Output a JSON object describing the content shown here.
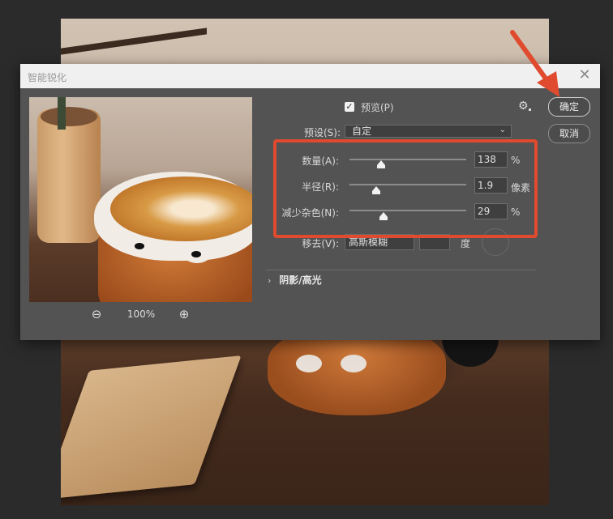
{
  "dialog": {
    "title": "智能锐化",
    "close_glyph": "✕"
  },
  "preview_panel": {
    "zoom_level": "100%",
    "zoom_out_glyph": "⊖",
    "zoom_in_glyph": "⊕"
  },
  "preview_toggle": {
    "checked": true,
    "check_glyph": "✓",
    "label": "预览(P)"
  },
  "gear_glyph": "⚙",
  "preset": {
    "label": "预设(S):",
    "value": "自定",
    "chevron": "⌄"
  },
  "sliders": [
    {
      "label": "数量(A):",
      "value": "138",
      "unit": "%",
      "fraction": 0.27
    },
    {
      "label": "半径(R):",
      "value": "1.9",
      "unit": "像素",
      "fraction": 0.23
    },
    {
      "label": "减少杂色(N):",
      "value": "29",
      "unit": "%",
      "fraction": 0.29
    }
  ],
  "remove": {
    "label": "移去(V):",
    "value": "高斯模糊",
    "angle_unit": "度"
  },
  "section": {
    "arrow": "›",
    "label": "阴影/高光"
  },
  "buttons": {
    "ok": "确定",
    "cancel": "取消"
  },
  "colors": {
    "dialog_bg": "#535353",
    "annotation_red": "#e04a2e"
  }
}
